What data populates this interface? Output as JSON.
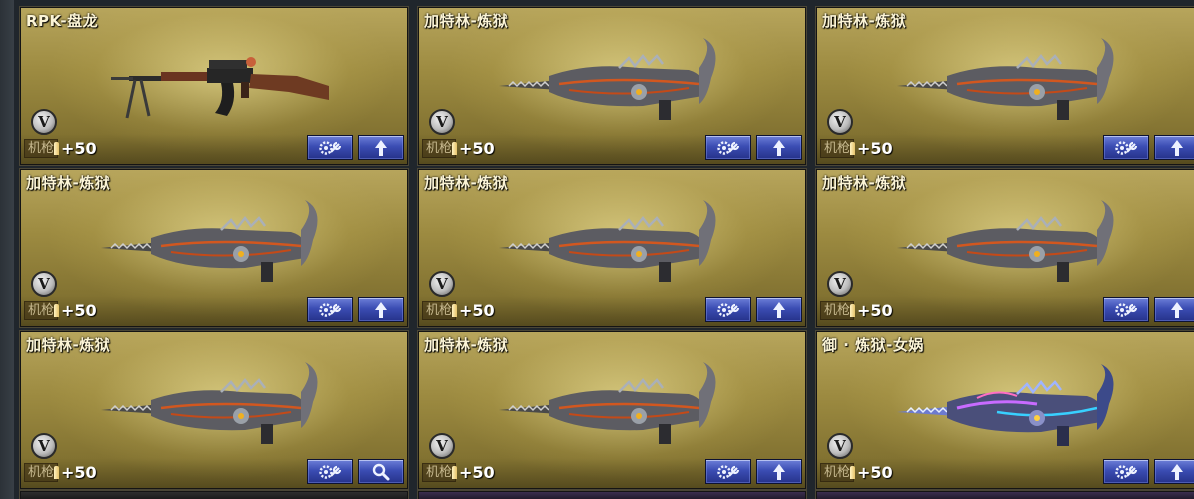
{
  "cards": [
    {
      "name": "RPK-盘龙",
      "category": "机枪",
      "bonus": "+50",
      "badge": "V",
      "weapon_icon": "rpk-icon",
      "action_icon": "arrow-up-icon"
    },
    {
      "name": "加特林-炼狱",
      "category": "机枪",
      "bonus": "+50",
      "badge": "V",
      "weapon_icon": "gatling-inferno-icon",
      "action_icon": "arrow-up-icon"
    },
    {
      "name": "加特林-炼狱",
      "category": "机枪",
      "bonus": "+50",
      "badge": "V",
      "weapon_icon": "gatling-inferno-icon",
      "action_icon": "arrow-up-icon"
    },
    {
      "name": "加特林-炼狱",
      "category": "机枪",
      "bonus": "+50",
      "badge": "V",
      "weapon_icon": "gatling-inferno-icon",
      "action_icon": "arrow-up-icon"
    },
    {
      "name": "加特林-炼狱",
      "category": "机枪",
      "bonus": "+50",
      "badge": "V",
      "weapon_icon": "gatling-inferno-icon",
      "action_icon": "arrow-up-icon"
    },
    {
      "name": "加特林-炼狱",
      "category": "机枪",
      "bonus": "+50",
      "badge": "V",
      "weapon_icon": "gatling-inferno-icon",
      "action_icon": "arrow-up-icon"
    },
    {
      "name": "加特林-炼狱",
      "category": "机枪",
      "bonus": "+50",
      "badge": "V",
      "weapon_icon": "gatling-inferno-icon",
      "action_icon": "search-icon"
    },
    {
      "name": "加特林-炼狱",
      "category": "机枪",
      "bonus": "+50",
      "badge": "V",
      "weapon_icon": "gatling-inferno-icon",
      "action_icon": "arrow-up-icon"
    },
    {
      "name": "御 · 炼狱-女娲",
      "category": "机枪",
      "bonus": "+50",
      "badge": "V",
      "weapon_icon": "gatling-nuwa-icon",
      "action_icon": "arrow-up-icon"
    }
  ],
  "colors": {
    "button_blue": "#3b4db3",
    "card_gold": "#9d8b41",
    "name_text": "#fbf4d6"
  }
}
